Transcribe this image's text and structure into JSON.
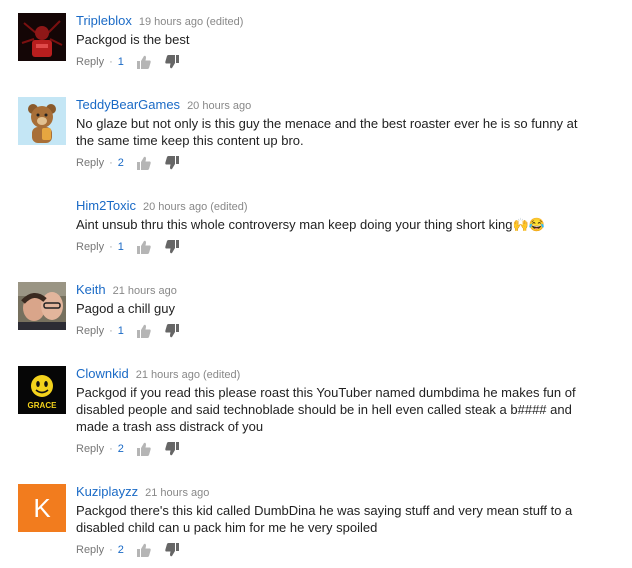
{
  "comments": [
    {
      "author": "Tripleblox",
      "time": "19 hours ago (edited)",
      "text": "Packgod is the best",
      "reply_label": "Reply",
      "likes": "1",
      "avatar": "dark-red-figure"
    },
    {
      "author": "TeddyBearGames",
      "time": "20 hours ago",
      "text": "No glaze but not only is this guy the menace and the best roaster ever he is so funny at the same time keep this content up bro.",
      "reply_label": "Reply",
      "likes": "2",
      "avatar": "teddy-bear"
    },
    {
      "author": "Him2Toxic",
      "time": "20 hours ago (edited)",
      "text": "Aint unsub thru this whole controversy man keep doing your thing short king🙌😂",
      "reply_label": "Reply",
      "likes": "1",
      "avatar": "none"
    },
    {
      "author": "Keith",
      "time": "21 hours ago",
      "text": "Pagod a chill guy",
      "reply_label": "Reply",
      "likes": "1",
      "avatar": "photo-two-people"
    },
    {
      "author": "Clownkid",
      "time": "21 hours ago (edited)",
      "text": "Packgod if you read this please roast this YouTuber named dumbdima he makes fun of disabled people and said technoblade should be in hell even called steak a b#### and made a trash ass distrack of you",
      "reply_label": "Reply",
      "likes": "2",
      "avatar": "smiley-grace",
      "avatar_text": "GRACE"
    },
    {
      "author": "Kuziplayzz",
      "time": "21 hours ago",
      "text": "Packgod there's this kid called DumbDina he was saying stuff and very mean stuff to a disabled child can u pack him for me he very spoiled",
      "reply_label": "Reply",
      "likes": "2",
      "avatar": "letter",
      "avatar_letter": "K",
      "avatar_color": "#f27c1e"
    }
  ],
  "colors": {
    "author": "#1a6ac6",
    "meta": "#888888",
    "text": "#222222"
  },
  "icons": {
    "like": "thumbs-up-icon",
    "dislike": "thumbs-down-icon"
  }
}
